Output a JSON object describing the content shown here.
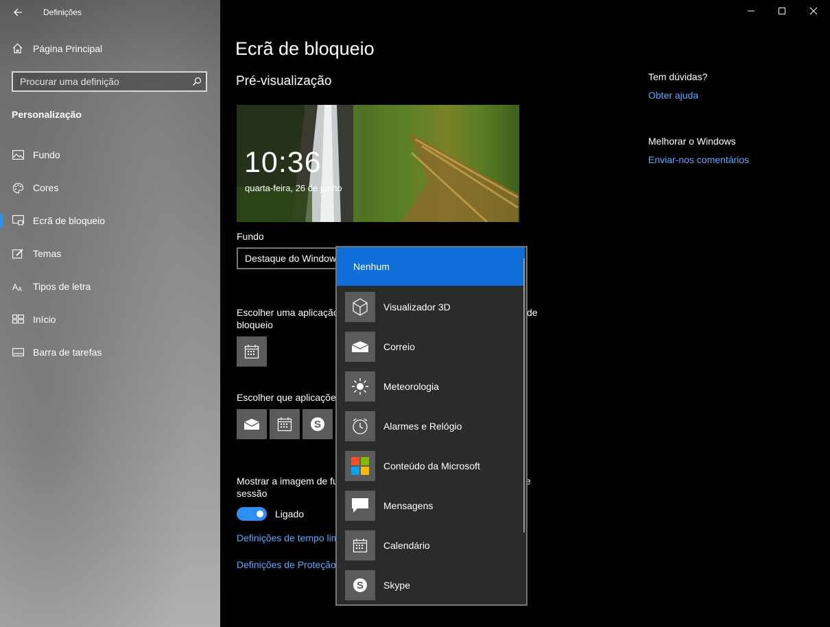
{
  "window": {
    "title": "Definições"
  },
  "sidebar": {
    "home_label": "Página Principal",
    "search_placeholder": "Procurar uma definição",
    "section_label": "Personalização",
    "items": [
      {
        "label": "Fundo",
        "icon": "picture-icon"
      },
      {
        "label": "Cores",
        "icon": "palette-icon"
      },
      {
        "label": "Ecrã de bloqueio",
        "icon": "lock-screen-icon",
        "active": true
      },
      {
        "label": "Temas",
        "icon": "brush-icon"
      },
      {
        "label": "Tipos de letra",
        "icon": "font-icon"
      },
      {
        "label": "Início",
        "icon": "start-icon"
      },
      {
        "label": "Barra de tarefas",
        "icon": "taskbar-icon"
      }
    ]
  },
  "main": {
    "title": "Ecrã de bloqueio",
    "preview_heading": "Pré-visualização",
    "preview": {
      "time": "10:36",
      "date": "quarta-feira, 26 de junho"
    },
    "background_label": "Fundo",
    "background_value": "Destaque do Windows",
    "detailed_app_label_a": "Escolher uma aplicação",
    "detailed_app_label_b": "de",
    "detailed_app_label_c": "bloqueio",
    "quick_apps_label": "Escolher que aplicações",
    "show_bg_label_a": "Mostrar a imagem de fu",
    "show_bg_label_b": "e",
    "show_bg_label_c": "sessão",
    "toggle_state": "Ligado",
    "link_timeout": "Definições de tempo lim",
    "link_screensaver": "Definições de Proteção"
  },
  "dropdown": {
    "selected": "Nenhum",
    "options": [
      {
        "label": "Visualizador 3D",
        "icon": "3d-viewer-icon"
      },
      {
        "label": "Correio",
        "icon": "mail-icon"
      },
      {
        "label": "Meteorologia",
        "icon": "weather-icon"
      },
      {
        "label": "Alarmes e Relógio",
        "icon": "alarm-clock-icon"
      },
      {
        "label": "Conteúdo da Microsoft",
        "icon": "microsoft-logo-icon"
      },
      {
        "label": "Mensagens",
        "icon": "messaging-icon"
      },
      {
        "label": "Calendário",
        "icon": "calendar-icon"
      },
      {
        "label": "Skype",
        "icon": "skype-icon"
      }
    ]
  },
  "help": {
    "question": "Tem dúvidas?",
    "get_help": "Obter ajuda",
    "improve": "Melhorar o Windows",
    "feedback": "Enviar-nos comentários"
  },
  "colors": {
    "accent": "#0f6fd8",
    "link": "#5ea8ff",
    "toggle_on": "#2f8ff0"
  }
}
